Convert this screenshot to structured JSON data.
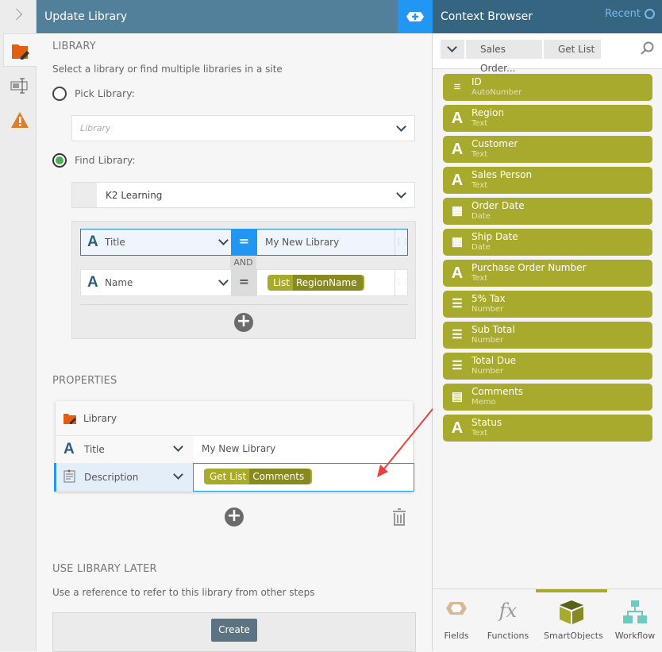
{
  "header": {
    "title": "Update Library"
  },
  "library": {
    "heading": "LIBRARY",
    "subtitle": "Select a library or find multiple libraries in a site",
    "pick_label": "Pick Library:",
    "pick_placeholder": "Library",
    "find_label": "Find Library:",
    "site_value": "K2 Learning",
    "filters": [
      {
        "field": "Title",
        "operator": "=",
        "value": "My New Library"
      },
      {
        "field": "Name",
        "operator": "=",
        "tag_source": "List",
        "tag_value": "RegionName"
      }
    ],
    "joiner": "AND"
  },
  "properties": {
    "heading": "PROPERTIES",
    "card_title": "Library",
    "rows": [
      {
        "field": "Title",
        "value": "My New Library"
      },
      {
        "field": "Description",
        "tag_source": "Get List",
        "tag_value": "Comments"
      }
    ]
  },
  "later": {
    "heading": "USE LIBRARY LATER",
    "text": "Use a reference to refer to this library from other steps",
    "create_label": "Create"
  },
  "context": {
    "title": "Context Browser",
    "recent_label": "Recent",
    "breadcrumb": [
      "Sales Order...",
      "Get List"
    ],
    "items": [
      {
        "name": "ID",
        "type": "AutoNumber",
        "icon": "autonumber"
      },
      {
        "name": "Region",
        "type": "Text",
        "icon": "A"
      },
      {
        "name": "Customer",
        "type": "Text",
        "icon": "A"
      },
      {
        "name": "Sales Person",
        "type": "Text",
        "icon": "A"
      },
      {
        "name": "Order Date",
        "type": "Date",
        "icon": "calendar"
      },
      {
        "name": "Ship Date",
        "type": "Date",
        "icon": "calendar"
      },
      {
        "name": "Purchase Order Number",
        "type": "Text",
        "icon": "A"
      },
      {
        "name": "5% Tax",
        "type": "Number",
        "icon": "number"
      },
      {
        "name": "Sub Total",
        "type": "Number",
        "icon": "number"
      },
      {
        "name": "Total Due",
        "type": "Number",
        "icon": "number"
      },
      {
        "name": "Comments",
        "type": "Memo",
        "icon": "memo"
      },
      {
        "name": "Status",
        "type": "Text",
        "icon": "A"
      }
    ],
    "tabs": [
      {
        "label": "Fields"
      },
      {
        "label": "Functions"
      },
      {
        "label": "SmartObjects",
        "active": true
      },
      {
        "label": "Workflow"
      }
    ]
  },
  "colors": {
    "header": "#527f99",
    "context_header": "#356580",
    "accent_blue": "#2196f3",
    "item": "#a8aa2e"
  }
}
